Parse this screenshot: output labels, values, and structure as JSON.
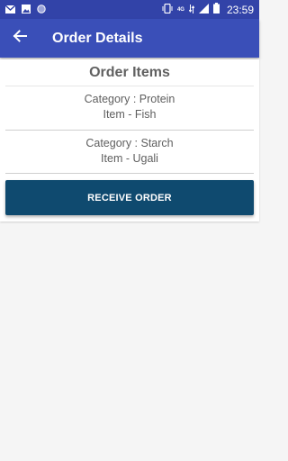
{
  "status_bar": {
    "time": "23:59",
    "network_label": "4G",
    "left_icons": [
      "gmail-icon",
      "image-icon",
      "circle-icon"
    ],
    "right_icons": [
      "vibrate-icon",
      "network-icon",
      "signal-icon",
      "battery-icon"
    ]
  },
  "app_bar": {
    "title": "Order Details",
    "back_icon": "arrow-back-icon",
    "color": "#3a4fb8"
  },
  "order_items": {
    "title": "Order Items",
    "items": [
      {
        "category": "Category : Protein",
        "item": "Item - Fish"
      },
      {
        "category": "Category : Starch",
        "item": "Item - Ugali"
      }
    ]
  },
  "actions": {
    "receive_label": "RECEIVE ORDER",
    "receive_color": "#0f4a6f"
  }
}
